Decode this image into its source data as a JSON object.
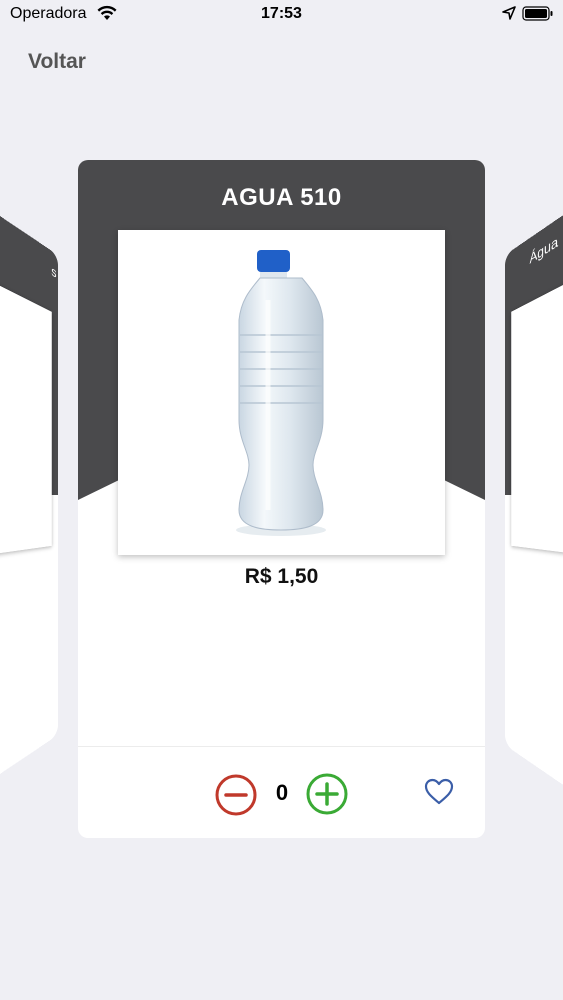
{
  "status_bar": {
    "carrier": "Operadora",
    "time": "17:53"
  },
  "nav": {
    "back_label": "Voltar"
  },
  "product": {
    "title": "AGUA 510",
    "price": "R$ 1,50",
    "quantity": "0"
  },
  "side_cards": {
    "left_title": "s",
    "right_title": "Água"
  },
  "colors": {
    "header_dark": "#4a4a4c",
    "minus": "#c0392b",
    "plus": "#3aaa35",
    "heart": "#3b5ea8",
    "background": "#efeff4"
  },
  "icons": {
    "wifi": "wifi-icon",
    "location": "location-arrow-icon",
    "battery": "battery-icon",
    "minus": "minus-circle-icon",
    "plus": "plus-circle-icon",
    "heart": "heart-outline-icon"
  }
}
